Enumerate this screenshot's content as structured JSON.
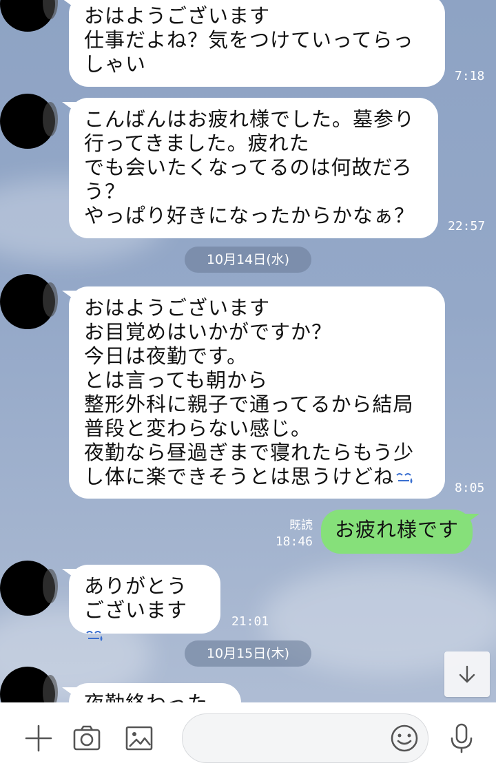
{
  "messages": [
    {
      "text": "おはようございます\n仕事だよね？気をつけていってらっ\nしゃい",
      "time": "7:18"
    },
    {
      "text": "こんばんはお疲れ様でした。墓参り\n行ってきました。疲れた\nでも会いたくなってるのは何故だろ\nう？\nやっぱり好きになったからかなぁ？",
      "time": "22:57"
    },
    {
      "text": "おはようございます\nお目覚めはいかがですか？\n今日は夜勤です。\nとは言っても朝から\n整形外科に親子で通ってるから結局\n普段と変わらない感じ。\n夜勤なら昼過ぎまで寝れたらもう少\nし体に楽できそうとは思うけどね",
      "time": "8:05"
    },
    {
      "text": "ありがとう\nございます",
      "time": "21:01"
    },
    {
      "text": "夜勤終わったよ"
    }
  ],
  "dates": [
    "10月14日(水)",
    "10月15日(木)"
  ],
  "outgoing": {
    "text": "お疲れ様です",
    "read": "既読",
    "time": "18:46"
  },
  "colors": {
    "outgoing_bubble": "#86e07a",
    "incoming_bubble": "#ffffff",
    "background": "#94a8c8"
  },
  "icons": {
    "scroll": "arrow-down-icon",
    "bar": [
      "plus-icon",
      "camera-icon",
      "image-icon",
      "emoji-icon",
      "microphone-icon"
    ]
  }
}
